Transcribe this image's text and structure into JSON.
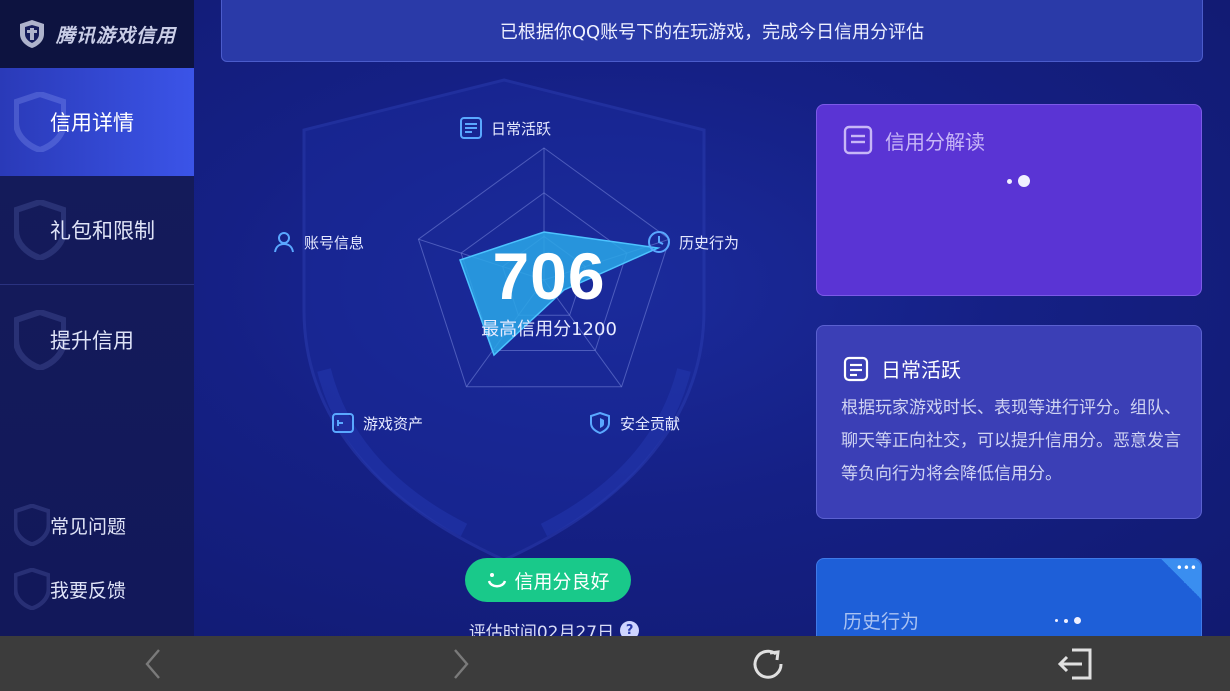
{
  "brand": {
    "name": "腾讯游戏信用",
    "icon": "shield-logo-icon"
  },
  "sidebar": {
    "items": [
      {
        "label": "信用详情",
        "active": true
      },
      {
        "label": "礼包和限制",
        "active": false
      },
      {
        "label": "提升信用",
        "active": false
      },
      {
        "label": "常见问题",
        "active": false
      },
      {
        "label": "我要反馈",
        "active": false
      }
    ]
  },
  "banner": {
    "text": "已根据你QQ账号下的在玩游戏，完成今日信用分评估"
  },
  "radar": {
    "labels": {
      "daily": "日常活跃",
      "history": "历史行为",
      "security": "安全贡献",
      "assets": "游戏资产",
      "account": "账号信息"
    },
    "score": "706",
    "max_score_text": "最高信用分1200",
    "status_button": "信用分良好",
    "eval_time": "评估时间02月27日",
    "help_icon": "?",
    "colors": {
      "fill": "#2aa7e8",
      "grid": "#6f7fd6"
    }
  },
  "cards": {
    "interpret": {
      "title": "信用分解读",
      "icon": "document-icon"
    },
    "daily": {
      "title": "日常活跃",
      "icon": "document-icon",
      "desc": "根据玩家游戏时长、表现等进行评分。组队、聊天等正向社交，可以提升信用分。恶意发言等负向行为将会降低信用分。"
    },
    "history": {
      "title": "历史行为",
      "corner_text": "•••"
    }
  },
  "bottombar": {
    "icons": [
      "back-arrow-icon",
      "forward-arrow-icon",
      "refresh-icon",
      "exit-icon"
    ]
  }
}
